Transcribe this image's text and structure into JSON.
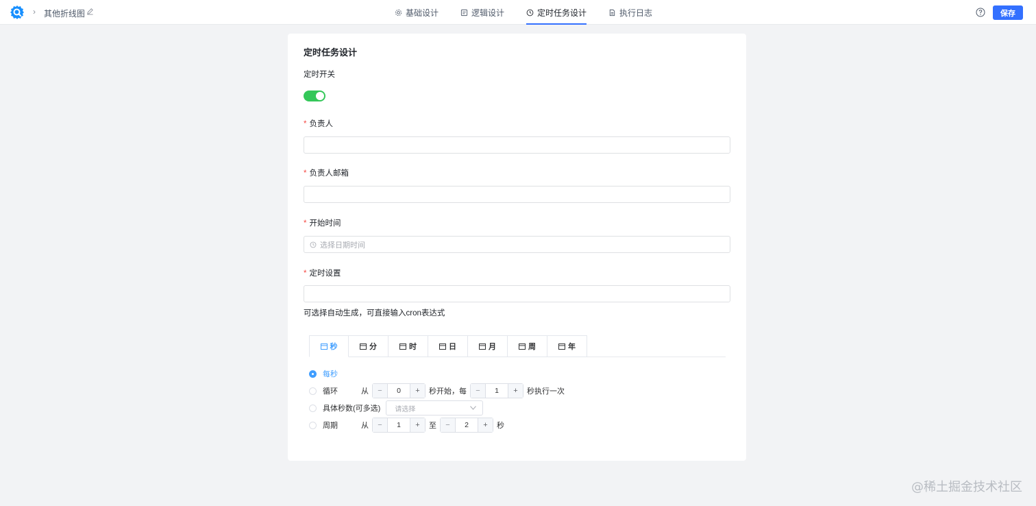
{
  "header": {
    "breadcrumb_title": "其他折线图",
    "tabs": [
      {
        "label": "基础设计",
        "icon": "gear-icon"
      },
      {
        "label": "逻辑设计",
        "icon": "document-icon"
      },
      {
        "label": "定时任务设计",
        "icon": "clock-icon",
        "active": true
      },
      {
        "label": "执行日志",
        "icon": "log-icon"
      }
    ],
    "save_label": "保存"
  },
  "form": {
    "title": "定时任务设计",
    "switch_label": "定时开关",
    "switch_on": true,
    "owner_label": "负责人",
    "owner_value": "",
    "email_label": "负责人邮箱",
    "email_value": "",
    "start_label": "开始时间",
    "start_placeholder": "选择日期时间",
    "schedule_label": "定时设置",
    "schedule_value": "",
    "hint": "可选择自动生成，可直接输入cron表达式",
    "required_mark": "*"
  },
  "cron": {
    "tabs": [
      "秒",
      "分",
      "时",
      "日",
      "月",
      "周",
      "年"
    ],
    "active_tab": "秒",
    "every": "每秒",
    "loop_label": "循环",
    "from": "从",
    "loop_start": "0",
    "loop_mid": "秒开始，每",
    "loop_step": "1",
    "loop_end": "秒执行一次",
    "specific_label": "具体秒数(可多选)",
    "specific_placeholder": "请选择",
    "period_label": "周期",
    "period_from": "1",
    "to": "至",
    "period_to": "2",
    "unit": "秒",
    "minus": "−",
    "plus": "+"
  },
  "watermark": "@稀土掘金技术社区",
  "colors": {
    "primary": "#3370ff",
    "switch_on": "#34c759",
    "radio_active": "#409eff",
    "required": "#f54a45"
  }
}
